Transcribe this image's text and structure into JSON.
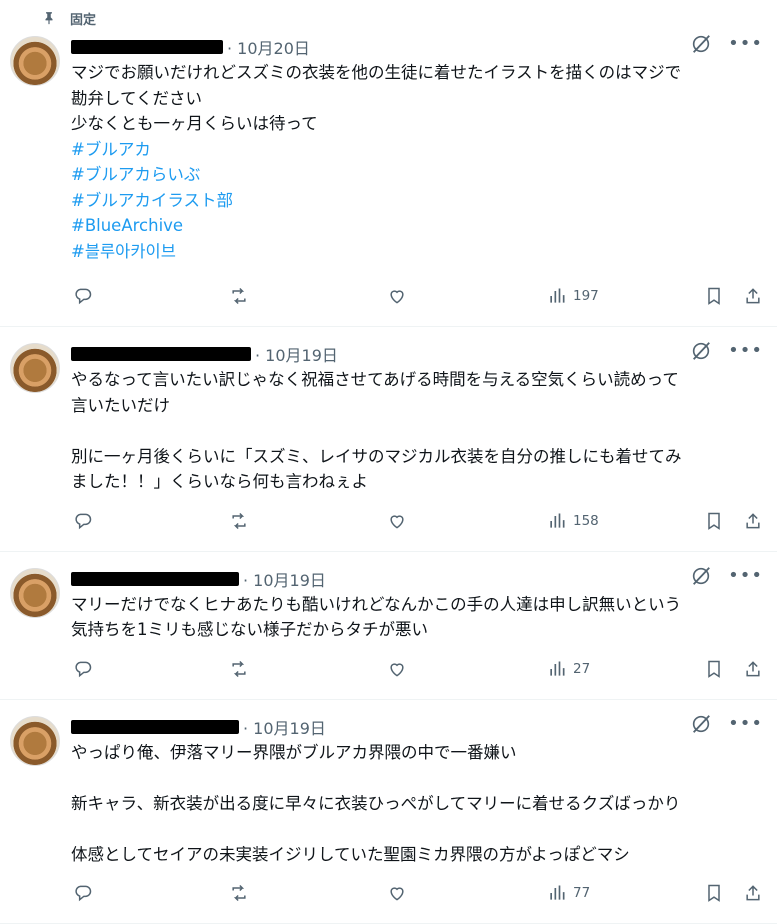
{
  "pinned_label": "固定",
  "tweets": [
    {
      "date": "· 10月20日",
      "lines": [
        {
          "text": "マジでお願いだけれどスズミの衣装を他の生徒に着せたイラストを描くのはマジで",
          "tag": false
        },
        {
          "text": "勘弁してください",
          "tag": false
        },
        {
          "text": "少なくとも一ヶ月くらいは待って",
          "tag": false
        },
        {
          "text": "#ブルアカ",
          "tag": true
        },
        {
          "text": "#ブルアカらいぶ",
          "tag": true
        },
        {
          "text": "#ブルアカイラスト部",
          "tag": true
        },
        {
          "text": "#BlueArchive",
          "tag": true
        },
        {
          "text": "#블루아카이브",
          "tag": true
        }
      ],
      "views": "197"
    },
    {
      "date": "· 10月19日",
      "lines": [
        {
          "text": "やるなって言いたい訳じゃなく祝福させてあげる時間を与える空気くらい読めって",
          "tag": false
        },
        {
          "text": "言いたいだけ",
          "tag": false
        },
        {
          "text": "",
          "tag": false
        },
        {
          "text": "別に一ヶ月後くらいに「スズミ、レイサのマジカル衣装を自分の推しにも着せてみ",
          "tag": false
        },
        {
          "text": "ました！！」くらいなら何も言わねぇよ",
          "tag": false
        }
      ],
      "views": "158"
    },
    {
      "date": "· 10月19日",
      "lines": [
        {
          "text": "マリーだけでなくヒナあたりも酷いけれどなんかこの手の人達は申し訳無いという",
          "tag": false
        },
        {
          "text": "気持ちを1ミリも感じない様子だからタチが悪い",
          "tag": false
        }
      ],
      "views": "27"
    },
    {
      "date": "· 10月19日",
      "lines": [
        {
          "text": "やっぱり俺、伊落マリー界隈がブルアカ界隈の中で一番嫌い",
          "tag": false
        },
        {
          "text": "",
          "tag": false
        },
        {
          "text": "新キャラ、新衣装が出る度に早々に衣装ひっぺがしてマリーに着せるクズばっかり",
          "tag": false
        },
        {
          "text": "",
          "tag": false
        },
        {
          "text": "体感としてセイアの未実装イジリしていた聖園ミカ界隈の方がよっぽどマシ",
          "tag": false
        }
      ],
      "views": "77"
    }
  ],
  "icons": {
    "reply": "reply-icon",
    "repost": "repost-icon",
    "like": "like-icon",
    "views": "views-icon",
    "bookmark": "bookmark-icon",
    "share": "share-icon",
    "grok": "grok-icon",
    "more": "more-icon",
    "pin": "pin-icon"
  },
  "colors": {
    "hashtag": "#1d9bf0",
    "muted": "#536471",
    "text": "#0f1419"
  }
}
